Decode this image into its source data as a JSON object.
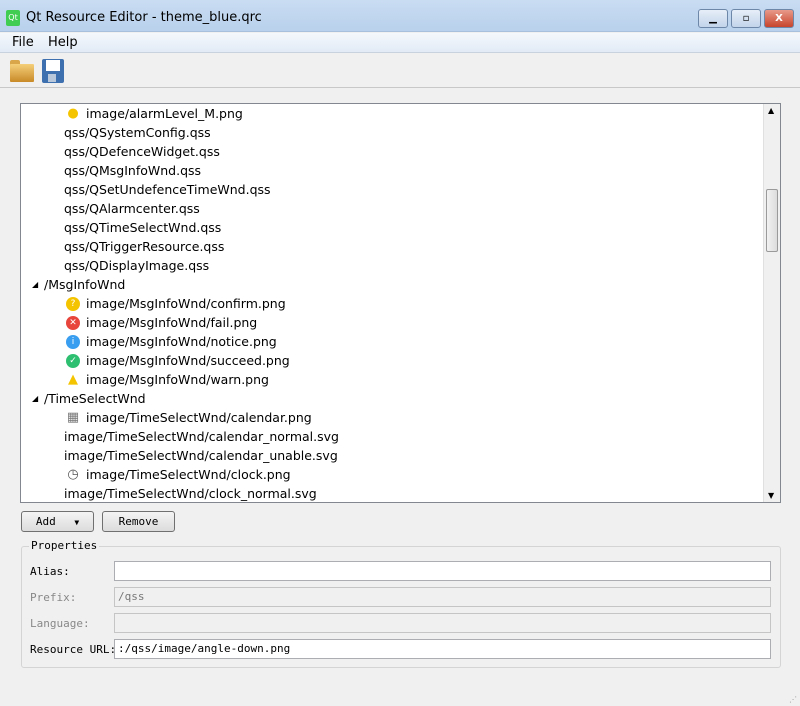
{
  "window": {
    "title": "Qt Resource Editor - theme_blue.qrc",
    "logo": "Qt",
    "minimize": "▁",
    "maximize": "▫",
    "close": "X"
  },
  "menu": [
    "File",
    "Help"
  ],
  "toolbar": {
    "open_icon": "folder-open-icon",
    "save_icon": "floppy-save-icon"
  },
  "tree": [
    {
      "label": "image/alarmLevel_M.png",
      "type": "item",
      "icon": "dot"
    },
    {
      "label": "qss/QSystemConfig.qss",
      "type": "item"
    },
    {
      "label": "qss/QDefenceWidget.qss",
      "type": "item"
    },
    {
      "label": "qss/QMsgInfoWnd.qss",
      "type": "item"
    },
    {
      "label": "qss/QSetUndefenceTimeWnd.qss",
      "type": "item"
    },
    {
      "label": "qss/QAlarmcenter.qss",
      "type": "item"
    },
    {
      "label": "qss/QTimeSelectWnd.qss",
      "type": "item"
    },
    {
      "label": "qss/QTriggerResource.qss",
      "type": "item"
    },
    {
      "label": "qss/QDisplayImage.qss",
      "type": "item"
    },
    {
      "label": "/MsgInfoWnd",
      "type": "group"
    },
    {
      "label": "image/MsgInfoWnd/confirm.png",
      "type": "item",
      "icon": "confirm"
    },
    {
      "label": "image/MsgInfoWnd/fail.png",
      "type": "item",
      "icon": "fail"
    },
    {
      "label": "image/MsgInfoWnd/notice.png",
      "type": "item",
      "icon": "notice"
    },
    {
      "label": "image/MsgInfoWnd/succeed.png",
      "type": "item",
      "icon": "succeed"
    },
    {
      "label": "image/MsgInfoWnd/warn.png",
      "type": "item",
      "icon": "warn"
    },
    {
      "label": "/TimeSelectWnd",
      "type": "group"
    },
    {
      "label": "image/TimeSelectWnd/calendar.png",
      "type": "item",
      "icon": "calendar"
    },
    {
      "label": "image/TimeSelectWnd/calendar_normal.svg",
      "type": "item"
    },
    {
      "label": "image/TimeSelectWnd/calendar_unable.svg",
      "type": "item"
    },
    {
      "label": "image/TimeSelectWnd/clock.png",
      "type": "item",
      "icon": "clock"
    },
    {
      "label": "image/TimeSelectWnd/clock_normal.svg",
      "type": "item"
    }
  ],
  "buttons": {
    "add": "Add",
    "remove": "Remove"
  },
  "properties": {
    "title": "Properties",
    "alias_label": "Alias:",
    "alias": "",
    "prefix_label": "Prefix:",
    "prefix": "/qss",
    "language_label": "Language:",
    "language": "",
    "url_label": "Resource URL:",
    "url": ":/qss/image/angle-down.png"
  }
}
